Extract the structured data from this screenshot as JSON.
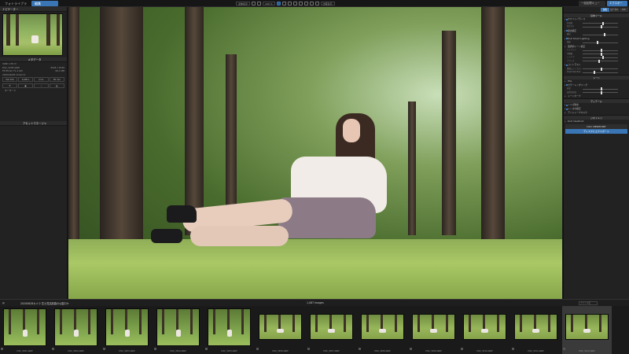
{
  "titlebar": {
    "tabs": [
      {
        "label": "フォトライブラリ"
      },
      {
        "label": "編集"
      }
    ],
    "batch_label": "一括処理キュー（ジョブ）",
    "export_label": "エクスポート"
  },
  "toolbar": {
    "zoom_fit": "全体表示",
    "zoom_pct": "100 %",
    "compare": "比較表示"
  },
  "left_panel": {
    "section_nav": "ナビゲーター",
    "section_meta": "メタデータ",
    "meta": {
      "camera": "SONY α7R IV",
      "lens_model": "FE 85mm F1.4 GM",
      "filename": "DSC_3205.ARW",
      "date": "2020/06/28 10:42:11",
      "size": "9504 x 6336",
      "file_size": "60.2 MB",
      "iso": "ISO 100",
      "speed": "1/400 s",
      "aperture": "f/1.4",
      "focal": "85 mm",
      "keyword_label": "キーワード"
    },
    "section_asset": "アセットマネージャ"
  },
  "right_panel": {
    "tabs": [
      "編集",
      "ローカル",
      "ICC"
    ],
    "groups": [
      "基本ツール",
      "トーン",
      "ディテール",
      "ジオメトリ"
    ],
    "items": [
      "ホワイトバランス",
      "露出補正",
      "DxO Smart Lighting",
      "選択的トーン補正",
      "コントラスト",
      "HSL",
      "カラーレンダリング",
      "トーンカーブ",
      "ノイズ除去",
      "レンズの補正",
      "アンシャープマスク",
      "DxO ViewPoint"
    ],
    "sliders": [
      {
        "label": "色温度",
        "level": 0.55
      },
      {
        "label": "色かぶり",
        "level": 0.5
      },
      {
        "label": "露出",
        "level": 0.6
      },
      {
        "label": "強度",
        "level": 0.4
      },
      {
        "label": "ハイライト",
        "level": 0.5
      },
      {
        "label": "中間調",
        "level": 0.5
      },
      {
        "label": "シャドウ",
        "level": 0.55
      },
      {
        "label": "ブラック",
        "level": 0.45
      },
      {
        "label": "微細コントラスト",
        "level": 0.5
      },
      {
        "label": "ClearView Plus",
        "level": 0.3
      },
      {
        "label": "彩度",
        "level": 0.5
      },
      {
        "label": "自然な彩度",
        "level": 0.5
      }
    ],
    "buttons": {
      "viewpoint": "DxO VIEWPOINT",
      "export_disk": "ディスクにエクスポート"
    }
  },
  "filmstrip": {
    "folder": "20200628カメラ 富士見高原森の公園ロケ",
    "count": "1,087 images",
    "filter_placeholder": "ファイル名",
    "files": [
      "DSC_3201.ARW",
      "DSC_3202.ARW",
      "DSC_3203.ARW",
      "DSC_3204.ARW",
      "DSC_3205.ARW",
      "DSC_3206.ARW",
      "DSC_3207.ARW",
      "DSC_3208.ARW",
      "DSC_3209.ARW",
      "DSC_3210.ARW",
      "DSC_3211.ARW",
      "DSC_3212.ARW"
    ]
  },
  "colors": {
    "accent": "#3a76b5",
    "panel": "#222222",
    "background": "#1b1b1b"
  }
}
